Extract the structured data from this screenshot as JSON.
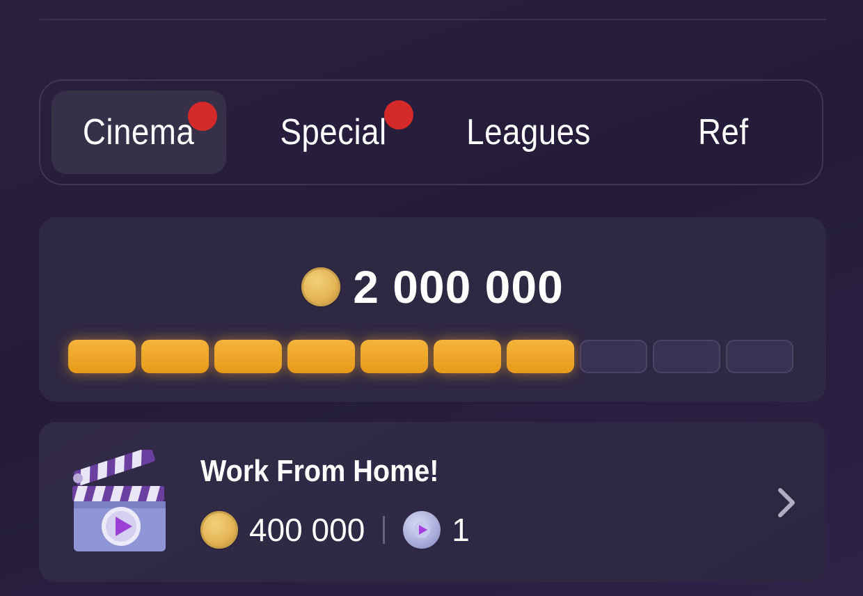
{
  "tabs": [
    {
      "label": "Cinema",
      "active": true,
      "notification": true
    },
    {
      "label": "Special",
      "active": false,
      "notification": true
    },
    {
      "label": "Leagues",
      "active": false,
      "notification": false
    },
    {
      "label": "Ref",
      "active": false,
      "notification": false
    }
  ],
  "progress": {
    "goal_amount": "2 000 000",
    "segments_total": 10,
    "segments_filled": 7,
    "fill_color": "#f0a52a"
  },
  "task": {
    "title": "Work From Home!",
    "coin_reward": "400 000",
    "ticket_reward": "1",
    "icon": "clapperboard-icon"
  },
  "colors": {
    "notification_dot": "#d42a2a",
    "background": "#241c39"
  }
}
